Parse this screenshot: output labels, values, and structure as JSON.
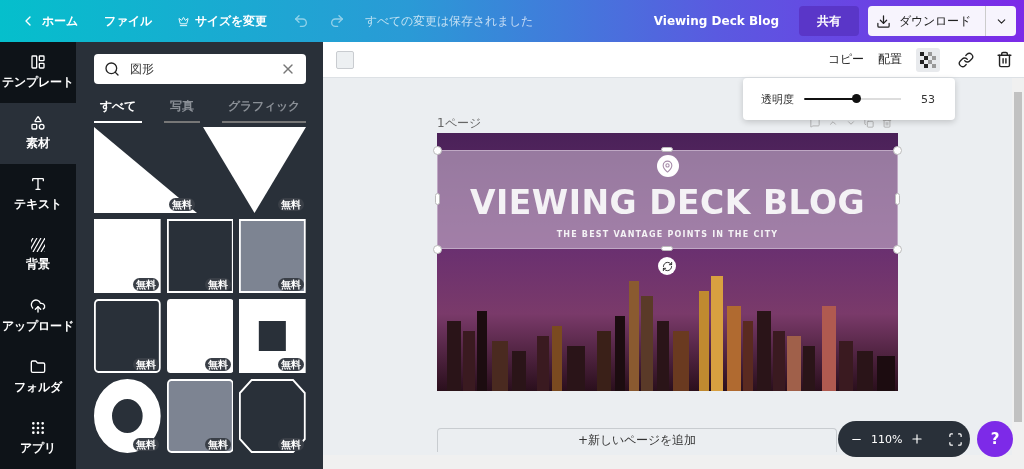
{
  "topbar": {
    "home": "ホーム",
    "file": "ファイル",
    "resize": "サイズを変更",
    "save_status": "すべての変更は保存されました",
    "doc_title": "Viewing Deck Blog",
    "share": "共有",
    "download": "ダウンロード"
  },
  "sidebar": {
    "items": [
      {
        "kind": "template",
        "label": "テンプレート",
        "selected": false
      },
      {
        "kind": "elements",
        "label": "素材",
        "selected": true
      },
      {
        "kind": "text",
        "label": "テキスト",
        "selected": false
      },
      {
        "kind": "background",
        "label": "背景",
        "selected": false
      },
      {
        "kind": "upload",
        "label": "アップロード",
        "selected": false
      },
      {
        "kind": "folder",
        "label": "フォルダ",
        "selected": false
      },
      {
        "kind": "apps",
        "label": "アプリ",
        "selected": false
      }
    ]
  },
  "panel": {
    "search": {
      "value": "図形"
    },
    "tabs": [
      {
        "label": "すべて",
        "selected": true
      },
      {
        "label": "写真",
        "selected": false
      },
      {
        "label": "グラフィック",
        "selected": false
      }
    ],
    "shapes": [
      {
        "kind": "triangle",
        "badge": "無料"
      },
      {
        "kind": "inverted-triangle",
        "badge": "無料"
      },
      {
        "kind": "square",
        "badge": "無料"
      },
      {
        "kind": "dark-square",
        "badge": "無料"
      },
      {
        "kind": "gray-square",
        "badge": "無料"
      },
      {
        "kind": "dark-rounded",
        "badge": "無料"
      },
      {
        "kind": "rounded",
        "badge": "無料"
      },
      {
        "kind": "square-frame",
        "badge": "無料"
      },
      {
        "kind": "ring",
        "badge": "無料"
      },
      {
        "kind": "gray-rounded",
        "badge": "無料"
      },
      {
        "kind": "octagon",
        "badge": "無料"
      }
    ]
  },
  "toolbar": {
    "copy": "コピー",
    "arrange": "配置"
  },
  "transparency": {
    "label": "透明度",
    "level": 0.53,
    "reading": "53"
  },
  "page": {
    "label": "1ページ",
    "title": "VIEWING DECK BLOG",
    "subtitle": "THE BEST VANTAGE POINTS IN THE CITY"
  },
  "add_page": "+新しいページを追加",
  "zoom": {
    "reading": "110%"
  },
  "help": "?"
}
